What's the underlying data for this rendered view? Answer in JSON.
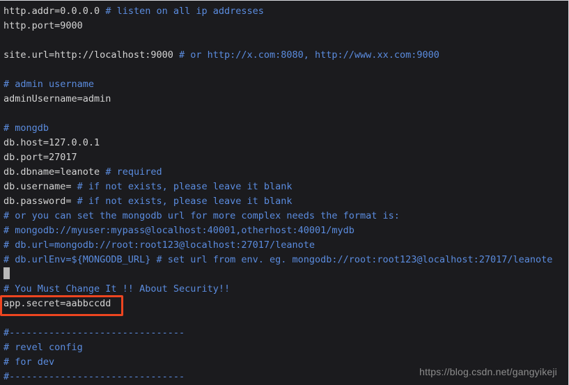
{
  "editor": {
    "background_color": "#1b1b1e",
    "plain_text_color": "#d4d4d4",
    "comment_color": "#5b8cdf",
    "highlight_color": "#ed4520",
    "cursor_color": "#b9b9b9"
  },
  "lines": [
    {
      "id": "line-http-addr",
      "segments": [
        {
          "kind": "plain",
          "text": "http.addr=0.0.0.0 "
        },
        {
          "kind": "comment",
          "text": "# listen on all ip addresses"
        }
      ]
    },
    {
      "id": "line-http-port",
      "segments": [
        {
          "kind": "plain",
          "text": "http.port=9000"
        }
      ]
    },
    {
      "id": "line-blank-1",
      "segments": [
        {
          "kind": "blank",
          "text": " "
        }
      ]
    },
    {
      "id": "line-site-url",
      "segments": [
        {
          "kind": "plain",
          "text": "site.url=http://localhost:9000 "
        },
        {
          "kind": "comment",
          "text": "# or http://x.com:8080, http://www.xx.com:9000"
        }
      ]
    },
    {
      "id": "line-blank-2",
      "segments": [
        {
          "kind": "blank",
          "text": " "
        }
      ]
    },
    {
      "id": "line-admin-comment",
      "segments": [
        {
          "kind": "comment",
          "text": "# admin username"
        }
      ]
    },
    {
      "id": "line-admin-username",
      "segments": [
        {
          "kind": "plain",
          "text": "adminUsername=admin"
        }
      ]
    },
    {
      "id": "line-blank-3",
      "segments": [
        {
          "kind": "blank",
          "text": " "
        }
      ]
    },
    {
      "id": "line-mongodb-header",
      "segments": [
        {
          "kind": "comment",
          "text": "# mongdb"
        }
      ]
    },
    {
      "id": "line-db-host",
      "segments": [
        {
          "kind": "plain",
          "text": "db.host=127.0.0.1"
        }
      ]
    },
    {
      "id": "line-db-port",
      "segments": [
        {
          "kind": "plain",
          "text": "db.port=27017"
        }
      ]
    },
    {
      "id": "line-db-dbname",
      "segments": [
        {
          "kind": "plain",
          "text": "db.dbname=leanote "
        },
        {
          "kind": "comment",
          "text": "# required"
        }
      ]
    },
    {
      "id": "line-db-username",
      "segments": [
        {
          "kind": "plain",
          "text": "db.username= "
        },
        {
          "kind": "comment",
          "text": "# if not exists, please leave it blank"
        }
      ]
    },
    {
      "id": "line-db-password",
      "segments": [
        {
          "kind": "plain",
          "text": "db.password= "
        },
        {
          "kind": "comment",
          "text": "# if not exists, please leave it blank"
        }
      ]
    },
    {
      "id": "line-url-note",
      "segments": [
        {
          "kind": "comment",
          "text": "# or you can set the mongodb url for more complex needs the format is:"
        }
      ]
    },
    {
      "id": "line-url-example",
      "segments": [
        {
          "kind": "comment",
          "text": "# mongodb://myuser:mypass@localhost:40001,otherhost:40001/mydb"
        }
      ]
    },
    {
      "id": "line-db-url",
      "segments": [
        {
          "kind": "comment",
          "text": "# db.url=mongodb://root:root123@localhost:27017/leanote"
        }
      ]
    },
    {
      "id": "line-db-urlenv",
      "segments": [
        {
          "kind": "comment",
          "text": "# db.urlEnv=${MONGODB_URL} # set url from env. eg. mongodb://root:root123@localhost:27017/leanote"
        }
      ]
    },
    {
      "id": "line-cursor",
      "segments": [
        {
          "kind": "cursor",
          "text": ""
        }
      ]
    },
    {
      "id": "line-security-note",
      "segments": [
        {
          "kind": "comment",
          "text": "# You Must Change It !! About Security!!"
        }
      ]
    },
    {
      "id": "line-app-secret",
      "segments": [
        {
          "kind": "plain",
          "text": "app.secret=aabbccdd"
        }
      ]
    },
    {
      "id": "line-blank-4",
      "segments": [
        {
          "kind": "blank",
          "text": " "
        }
      ]
    },
    {
      "id": "line-separator-top",
      "segments": [
        {
          "kind": "comment",
          "text": "#-------------------------------"
        }
      ]
    },
    {
      "id": "line-revel-config",
      "segments": [
        {
          "kind": "comment",
          "text": "# revel config"
        }
      ]
    },
    {
      "id": "line-for-dev",
      "segments": [
        {
          "kind": "comment",
          "text": "# for dev"
        }
      ]
    },
    {
      "id": "line-separator-bot",
      "segments": [
        {
          "kind": "comment",
          "text": "#-------------------------------"
        }
      ]
    }
  ],
  "annotation": {
    "target_line": "app.secret=aabbccdd",
    "shape": "rectangle",
    "color": "#ed4520"
  },
  "watermark": {
    "text": "https://blog.csdn.net/gangyikeji"
  }
}
